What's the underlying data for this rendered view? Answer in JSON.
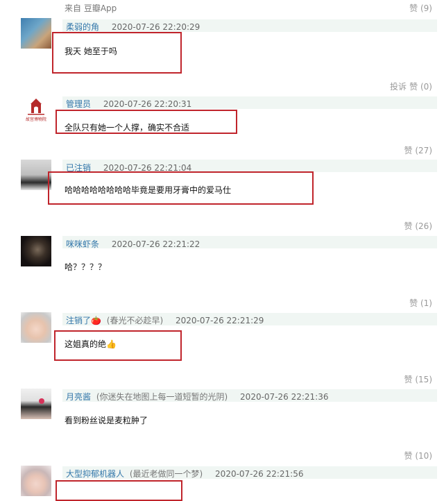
{
  "top_source": "来自 豆瓣App",
  "top_like": "赞 (9)",
  "report_label": "投诉",
  "comments": [
    {
      "author": "柔弱的角",
      "aux": "",
      "time": "2020-07-26 22:20:29",
      "content": "我天 她至于吗",
      "like": "赞 (0)"
    },
    {
      "author": "管理员",
      "aux": "",
      "time": "2020-07-26 22:20:31",
      "content": "全队只有她一个人撑，确实不合适",
      "like": "赞 (27)",
      "avatar_caption": "故宫博物院"
    },
    {
      "author": "已注销",
      "aux": "",
      "time": "2020-07-26 22:21:04",
      "content": "哈哈哈哈哈哈哈哈毕竟是要用牙膏中的爱马仕",
      "like": "赞 (26)"
    },
    {
      "author": "咪咪虾条",
      "aux": "",
      "time": "2020-07-26 22:21:22",
      "content": "哈？？？？",
      "like": "赞 (1)"
    },
    {
      "author": "注销了🍅",
      "aux": "(春光不必趁早)",
      "time": "2020-07-26 22:21:29",
      "content": "这姐真的绝👍",
      "like": "赞 (15)"
    },
    {
      "author": "月亮酱",
      "aux": "(你迷失在地图上每一道短暂的光阴)",
      "time": "2020-07-26 22:21:36",
      "content": "看到粉丝说是麦粒肿了",
      "like": "赞 (10)"
    },
    {
      "author": "大型抑郁机器人",
      "aux": "(最近老做同一个梦)",
      "time": "2020-07-26 22:21:56",
      "content": "",
      "like": ""
    }
  ]
}
